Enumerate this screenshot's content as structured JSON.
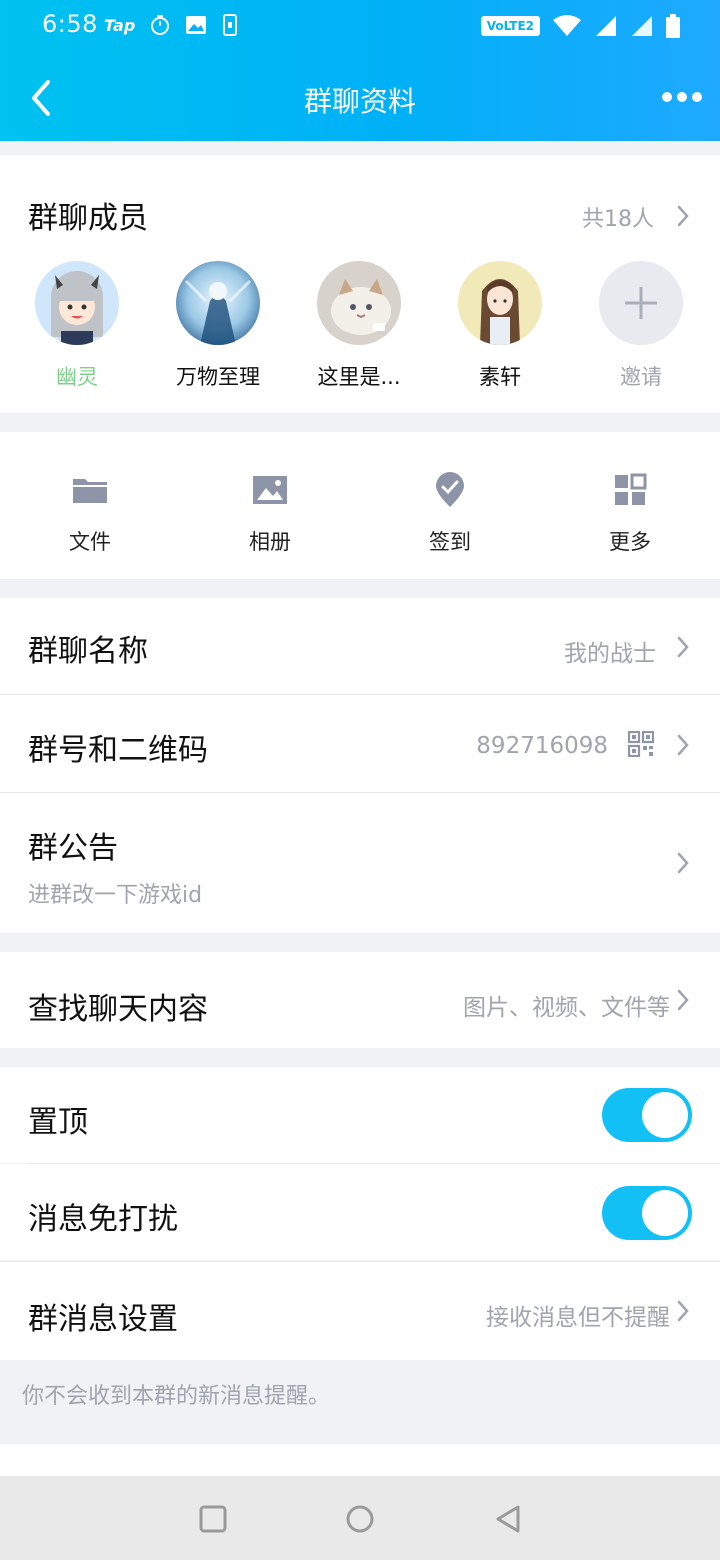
{
  "status_bar": {
    "time": "6:58",
    "tap_label": "Tap",
    "volte_label": "VoLTE2"
  },
  "app_bar": {
    "title": "群聊资料"
  },
  "members": {
    "heading": "群聊成员",
    "count_label": "共18人",
    "list": [
      {
        "name": "幽灵"
      },
      {
        "name": "万物至理"
      },
      {
        "name": "这里是..."
      },
      {
        "name": "素轩"
      },
      {
        "name": "邀请"
      }
    ]
  },
  "quick_actions": [
    {
      "label": "文件",
      "icon": "folder-icon"
    },
    {
      "label": "相册",
      "icon": "image-icon"
    },
    {
      "label": "签到",
      "icon": "location-check-icon"
    },
    {
      "label": "更多",
      "icon": "grid-icon"
    }
  ],
  "settings": {
    "group_name": {
      "label": "群聊名称",
      "value": "我的战士"
    },
    "group_number": {
      "label": "群号和二维码",
      "value": "892716098"
    },
    "announcement": {
      "label": "群公告",
      "subtitle": "进群改一下游戏id"
    },
    "search": {
      "label": "查找聊天内容",
      "value": "图片、视频、文件等"
    },
    "pin": {
      "label": "置顶",
      "enabled": true
    },
    "mute": {
      "label": "消息免打扰",
      "enabled": true
    },
    "message_settings": {
      "label": "群消息设置",
      "value": "接收消息但不提醒"
    },
    "hint": "你不会收到本群的新消息提醒。"
  },
  "colors": {
    "accent": "#12c0f5",
    "header_start": "#00c2f0",
    "header_end": "#1ea9ff",
    "secondary_text": "#a0a4ad",
    "icon_gray": "#8e94a8"
  }
}
